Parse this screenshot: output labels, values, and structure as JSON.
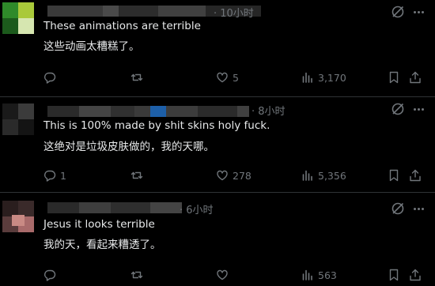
{
  "posts": [
    {
      "time": "· 10小时",
      "text_en": "These animations are terrible",
      "text_zh": "这些动画太糟糕了。",
      "reply_count": "",
      "repost_count": "",
      "like_count": "5",
      "view_count": "3,170"
    },
    {
      "time": "· 8小时",
      "text_en": "This is 100% made by shit skins holy fuck.",
      "text_zh": "这绝对是垃圾皮肤做的，我的天哪。",
      "reply_count": "1",
      "repost_count": "",
      "like_count": "278",
      "view_count": "5,356"
    },
    {
      "time": "· 6小时",
      "text_en": "Jesus it looks terrible",
      "text_zh": "我的天，看起来糟透了。",
      "reply_count": "",
      "repost_count": "",
      "like_count": "",
      "view_count": "563"
    }
  ],
  "icons": {
    "reply": "reply-icon",
    "repost": "repost-icon",
    "like": "like-icon",
    "views": "views-icon",
    "bookmark": "bookmark-icon",
    "share": "share-icon",
    "grok": "grok-icon",
    "more": "more-icon"
  },
  "colors": {
    "background": "#000000",
    "text": "#e7e9ea",
    "muted": "#71767b",
    "divider": "#2f3336"
  }
}
